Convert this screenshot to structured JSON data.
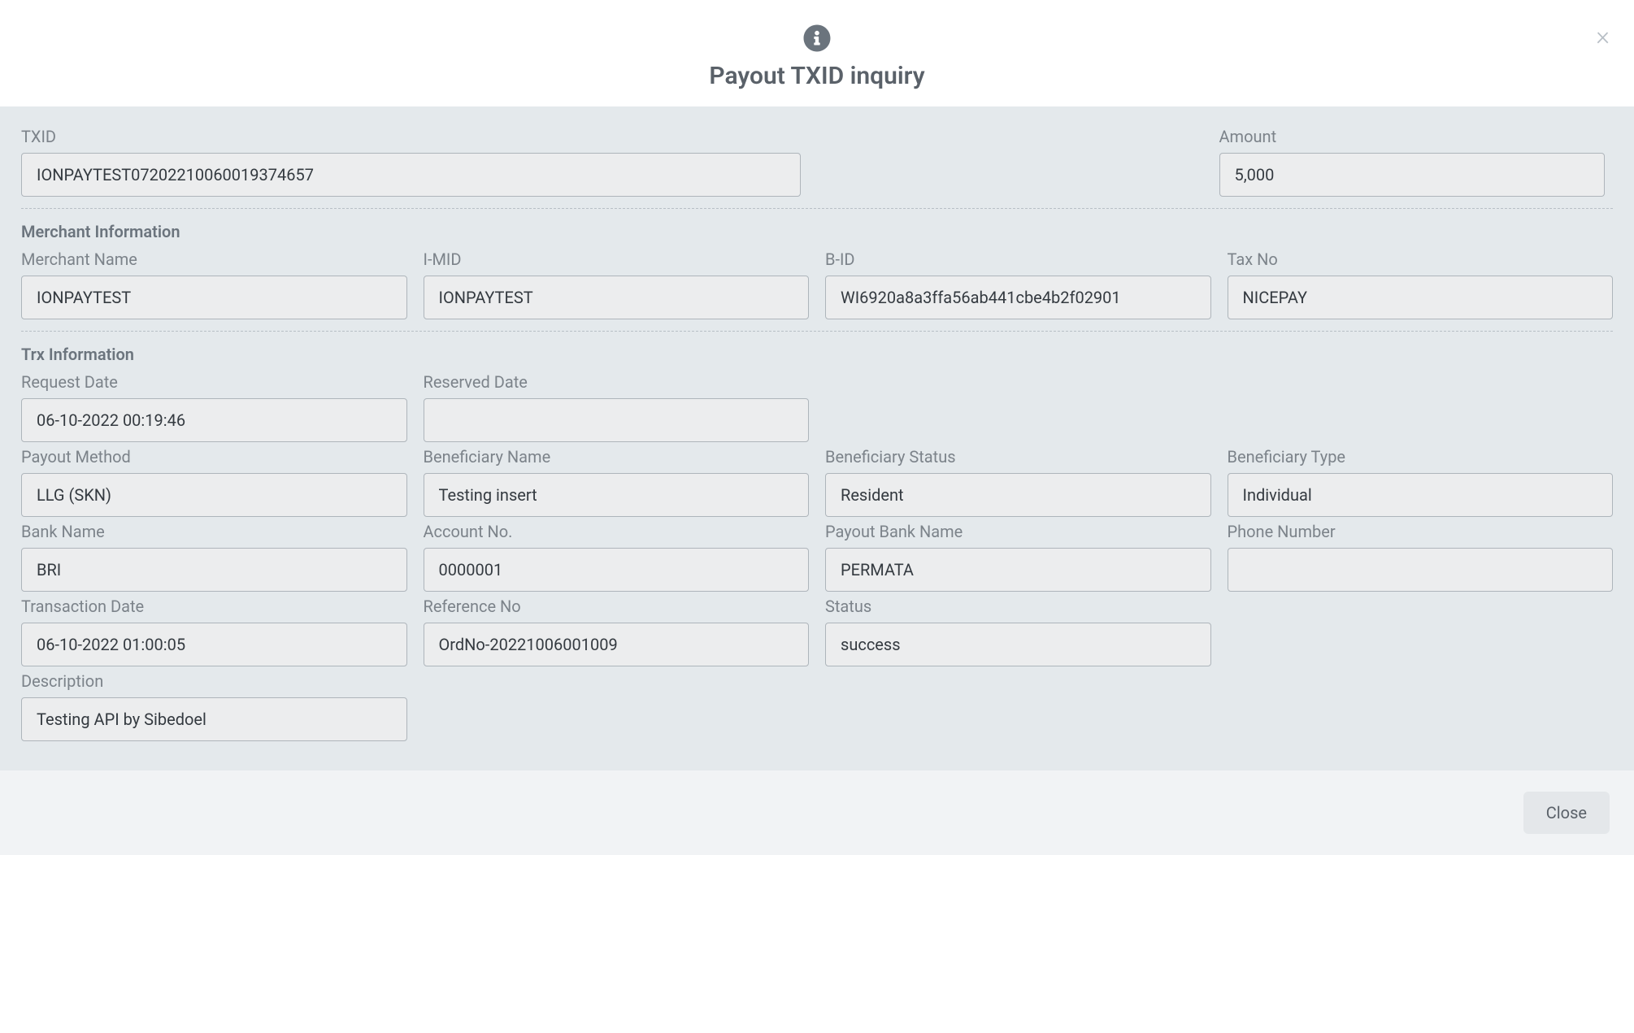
{
  "header": {
    "title": "Payout TXID inquiry",
    "close_x": "×"
  },
  "top": {
    "txid_label": "TXID",
    "txid_value": "IONPAYTEST07202210060019374657",
    "amount_label": "Amount",
    "amount_value": "5,000"
  },
  "merchant": {
    "section_title": "Merchant Information",
    "name_label": "Merchant Name",
    "name_value": "IONPAYTEST",
    "imid_label": "I-MID",
    "imid_value": "IONPAYTEST",
    "bid_label": "B-ID",
    "bid_value": "WI6920a8a3ffa56ab441cbe4b2f02901",
    "taxno_label": "Tax No",
    "taxno_value": "NICEPAY"
  },
  "trx": {
    "section_title": "Trx Information",
    "request_date_label": "Request Date",
    "request_date_value": "06-10-2022 00:19:46",
    "reserved_date_label": "Reserved Date",
    "reserved_date_value": "",
    "payout_method_label": "Payout Method",
    "payout_method_value": "LLG (SKN)",
    "beneficiary_name_label": "Beneficiary Name",
    "beneficiary_name_value": "Testing insert",
    "beneficiary_status_label": "Beneficiary Status",
    "beneficiary_status_value": "Resident",
    "beneficiary_type_label": "Beneficiary Type",
    "beneficiary_type_value": "Individual",
    "bank_name_label": "Bank Name",
    "bank_name_value": "BRI",
    "account_no_label": "Account No.",
    "account_no_value": "0000001",
    "payout_bank_name_label": "Payout Bank Name",
    "payout_bank_name_value": "PERMATA",
    "phone_number_label": "Phone Number",
    "phone_number_value": "",
    "transaction_date_label": "Transaction Date",
    "transaction_date_value": "06-10-2022 01:00:05",
    "reference_no_label": "Reference No",
    "reference_no_value": "OrdNo-20221006001009",
    "status_label": "Status",
    "status_value": "success",
    "description_label": "Description",
    "description_value": "Testing API by Sibedoel"
  },
  "footer": {
    "close_label": "Close"
  }
}
